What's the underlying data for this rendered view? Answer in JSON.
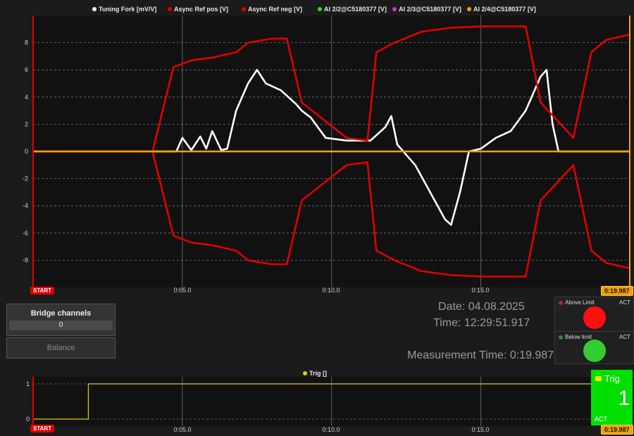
{
  "main_chart": {
    "legend": [
      {
        "label": "Tuning Fork [mV/V]",
        "color": "#ffffff"
      },
      {
        "label": "Async Ref pos [V]",
        "color": "#e00000"
      },
      {
        "label": "Async Ref neg [V]",
        "color": "#e00000"
      },
      {
        "label": "AI 2/2@C5180377 [V]",
        "color": "#33dd33"
      },
      {
        "label": "AI 2/3@C5180377 [V]",
        "color": "#cc33cc"
      },
      {
        "label": "AI 2/4@C5180377 [V]",
        "color": "#f5a000"
      }
    ],
    "y_ticks": [
      "8",
      "6",
      "4",
      "2",
      "0",
      "-2",
      "-4",
      "-6",
      "-8"
    ],
    "x_ticks": [
      "0:05.0",
      "0:10.0",
      "0:15.0"
    ],
    "start_label": "START",
    "end_label": "0:19.987"
  },
  "chart_data": [
    {
      "type": "line",
      "xlim": [
        0,
        19.987
      ],
      "ylim": [
        -10,
        10
      ],
      "series": [
        {
          "name": "Tuning Fork [mV/V]",
          "color": "#ffffff",
          "points": [
            [
              0,
              0
            ],
            [
              4,
              0
            ],
            [
              4.8,
              0
            ],
            [
              5,
              1
            ],
            [
              5.3,
              0.1
            ],
            [
              5.6,
              1.1
            ],
            [
              5.8,
              0.2
            ],
            [
              6,
              1.5
            ],
            [
              6.3,
              0.1
            ],
            [
              6.5,
              0.2
            ],
            [
              6.8,
              3
            ],
            [
              7.2,
              5
            ],
            [
              7.5,
              6
            ],
            [
              7.8,
              5
            ],
            [
              8.3,
              4.5
            ],
            [
              8.8,
              3.5
            ],
            [
              9,
              3
            ],
            [
              9.3,
              2.5
            ],
            [
              9.8,
              1
            ],
            [
              10.5,
              0.8
            ],
            [
              11.3,
              0.8
            ],
            [
              11.8,
              1.8
            ],
            [
              12.0,
              2.6
            ],
            [
              12.2,
              0.5
            ],
            [
              12.8,
              -1
            ],
            [
              13.3,
              -3
            ],
            [
              13.8,
              -5
            ],
            [
              14.0,
              -5.4
            ],
            [
              14.3,
              -3
            ],
            [
              14.6,
              0
            ],
            [
              15,
              0.2
            ],
            [
              15.5,
              1
            ],
            [
              16,
              1.5
            ],
            [
              16.5,
              3
            ],
            [
              17,
              5.5
            ],
            [
              17.2,
              6
            ],
            [
              17.4,
              2
            ],
            [
              17.6,
              0
            ],
            [
              19.987,
              0
            ]
          ]
        },
        {
          "name": "Async Ref pos [V]",
          "color": "#e00000",
          "points": [
            [
              0,
              0
            ],
            [
              4,
              0
            ],
            [
              4.7,
              6.2
            ],
            [
              5.3,
              6.7
            ],
            [
              6,
              6.9
            ],
            [
              6.8,
              7.3
            ],
            [
              7.2,
              8
            ],
            [
              8,
              8.3
            ],
            [
              8.5,
              8.3
            ],
            [
              9.0,
              3.6
            ],
            [
              10.5,
              1.0
            ],
            [
              11.2,
              0.8
            ],
            [
              11.5,
              7.3
            ],
            [
              12.1,
              8
            ],
            [
              13,
              8.8
            ],
            [
              14,
              9.1
            ],
            [
              15,
              9.2
            ],
            [
              16.5,
              9.2
            ],
            [
              17.0,
              3.6
            ],
            [
              18.1,
              1.0
            ],
            [
              18.7,
              7.3
            ],
            [
              19.2,
              8.2
            ],
            [
              19.987,
              8.6
            ]
          ]
        },
        {
          "name": "Async Ref neg [V]",
          "color": "#e00000",
          "points": [
            [
              0,
              0
            ],
            [
              4,
              0
            ],
            [
              4.7,
              -6.2
            ],
            [
              5.3,
              -6.7
            ],
            [
              6,
              -6.9
            ],
            [
              6.8,
              -7.3
            ],
            [
              7.2,
              -8
            ],
            [
              8,
              -8.3
            ],
            [
              8.5,
              -8.3
            ],
            [
              9.0,
              -3.6
            ],
            [
              10.5,
              -1.0
            ],
            [
              11.2,
              -0.8
            ],
            [
              11.5,
              -7.3
            ],
            [
              12.1,
              -8
            ],
            [
              13,
              -8.8
            ],
            [
              14,
              -9.1
            ],
            [
              15,
              -9.2
            ],
            [
              16.5,
              -9.2
            ],
            [
              17.0,
              -3.6
            ],
            [
              18.1,
              -1.0
            ],
            [
              18.7,
              -7.3
            ],
            [
              19.2,
              -8.2
            ],
            [
              19.987,
              -8.6
            ]
          ]
        },
        {
          "name": "AI 2/4@C5180377 [V]",
          "color": "#f5a000",
          "points": [
            [
              0,
              0
            ],
            [
              19.987,
              0
            ]
          ]
        }
      ]
    },
    {
      "type": "line",
      "xlim": [
        0,
        19.987
      ],
      "ylim": [
        -0.2,
        1.2
      ],
      "series": [
        {
          "name": "Trig []",
          "color": "#e0d000",
          "points": [
            [
              0,
              0
            ],
            [
              1.85,
              0
            ],
            [
              1.85,
              1
            ],
            [
              19.987,
              1
            ]
          ]
        }
      ]
    }
  ],
  "bridge": {
    "title": "Bridge channels",
    "value": "0",
    "balance_label": "Balance"
  },
  "info": {
    "date": "Date: 04.08.2025",
    "time": "Time: 12:29:51.917",
    "measurement": "Measurement Time: 0:19.987"
  },
  "limits": [
    {
      "label": "Above Limit",
      "act": "ACT",
      "dot_color": "#a03030",
      "lamp_color": "#ff1010"
    },
    {
      "label": "Below limit",
      "act": "ACT",
      "dot_color": "#2f8a2f",
      "lamp_color": "#33cc33"
    }
  ],
  "trig_chart": {
    "legend": "Trig []",
    "legend_color": "#e0d000",
    "y_ticks": [
      "1",
      "0"
    ],
    "x_ticks": [
      "0:05.0",
      "0:10.0",
      "0:15.0"
    ],
    "start_label": "START",
    "end_label": "0:19.987"
  },
  "trig_panel": {
    "title": "Trig",
    "value": "1",
    "act": "ACT",
    "bg_color": "#00e000"
  }
}
